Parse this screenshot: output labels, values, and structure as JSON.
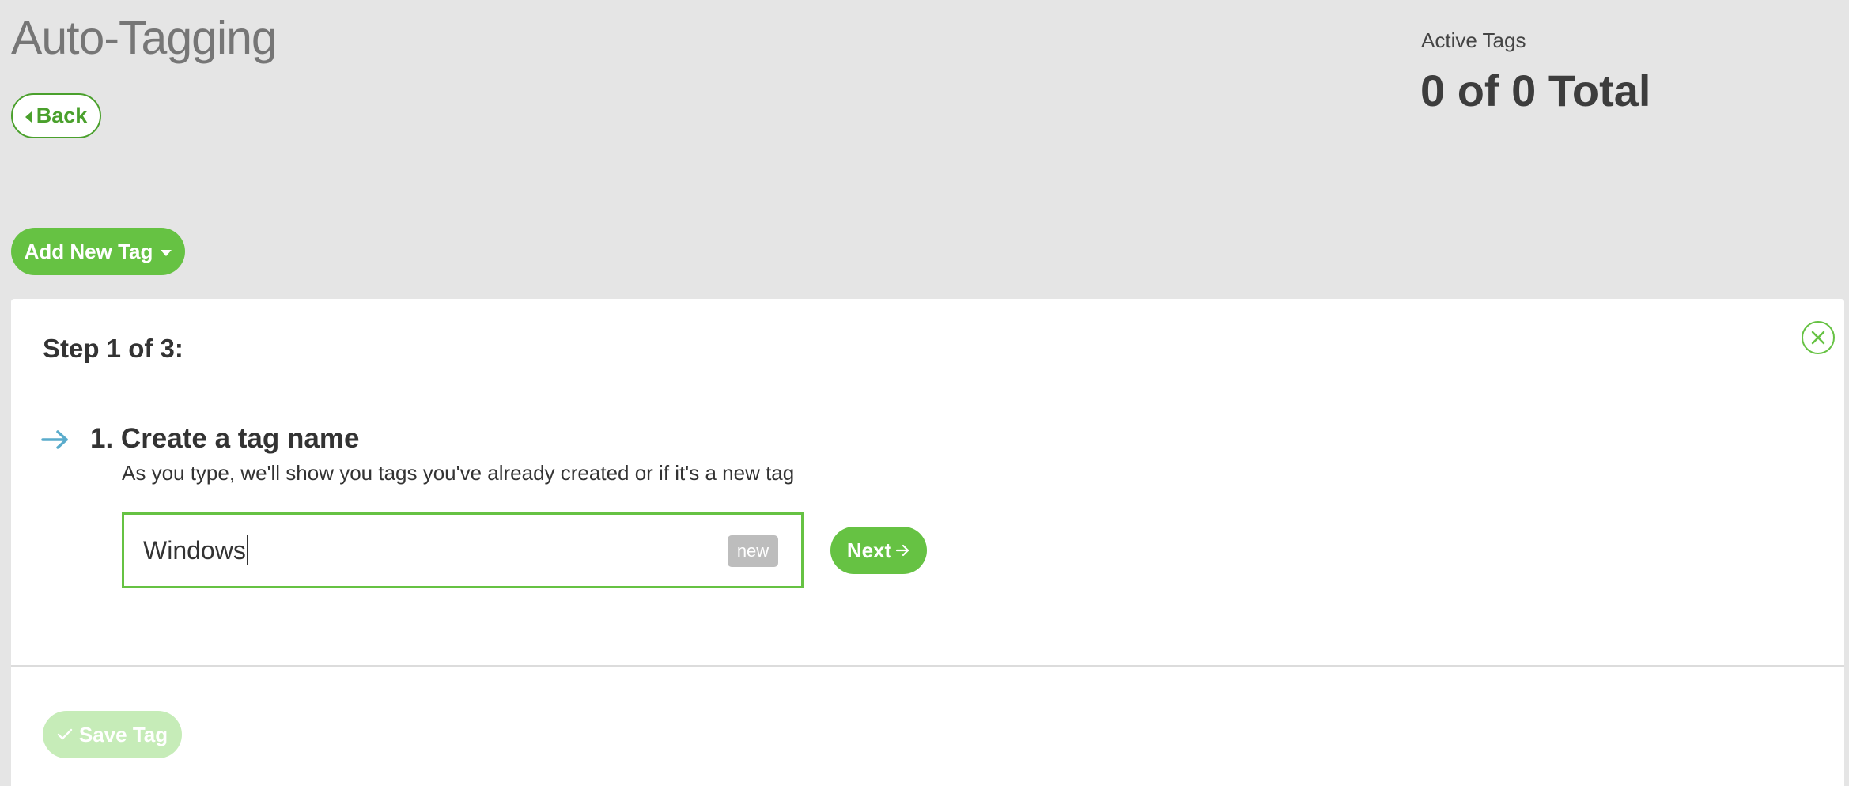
{
  "header": {
    "title": "Auto-Tagging",
    "back_label": "Back"
  },
  "summary": {
    "label": "Active Tags",
    "total": "0 of 0 Total"
  },
  "toolbar": {
    "add_tag_label": "Add New Tag"
  },
  "wizard": {
    "step_title": "Step 1 of 3:",
    "step1": {
      "title": "1. Create a tag name",
      "hint": "As you type, we'll show you tags you've already created or if it's a new tag"
    },
    "tag_input": {
      "value": "Windows",
      "badge": "new"
    },
    "next_label": "Next",
    "save_label": "Save Tag"
  },
  "colors": {
    "accent": "#66c243",
    "accent_dark": "#4aa02c",
    "arrow": "#5aaccc",
    "disabled_button": "#c6ecb8",
    "badge": "#bdbdbd",
    "background": "#e5e5e5"
  },
  "icons": {
    "back": "caret-left-icon",
    "add_tag": "caret-down-icon",
    "close": "close-icon",
    "step_arrow": "arrow-right-icon",
    "next": "arrow-right-icon",
    "save": "check-icon"
  }
}
